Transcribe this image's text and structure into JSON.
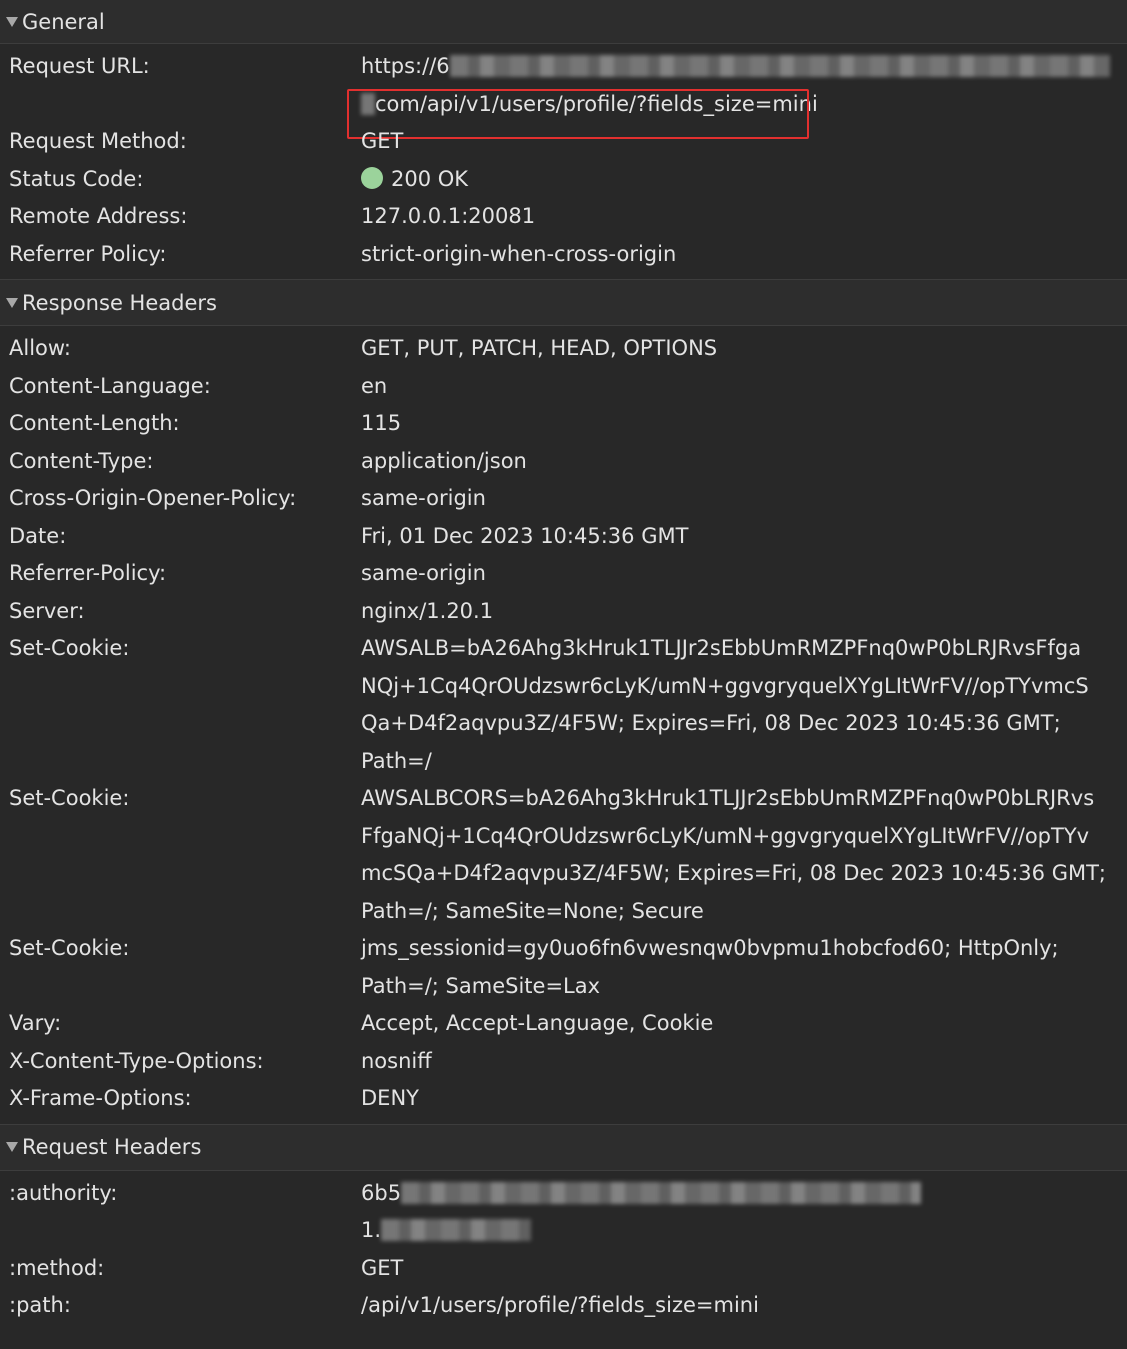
{
  "general": {
    "title": "General",
    "request_url_key": "Request URL:",
    "request_url_line1": "https://6",
    "request_url_line2": "com/api/v1/users/profile/?fields_size=mini",
    "request_method_key": "Request Method:",
    "request_method": "GET",
    "status_code_key": "Status Code:",
    "status_code": "200 OK",
    "remote_address_key": "Remote Address:",
    "remote_address": "127.0.0.1:20081",
    "referrer_policy_key": "Referrer Policy:",
    "referrer_policy": "strict-origin-when-cross-origin"
  },
  "response_headers": {
    "title": "Response Headers",
    "allow_key": "Allow:",
    "allow": "GET, PUT, PATCH, HEAD, OPTIONS",
    "content_language_key": "Content-Language:",
    "content_language": "en",
    "content_length_key": "Content-Length:",
    "content_length": "115",
    "content_type_key": "Content-Type:",
    "content_type": "application/json",
    "coop_key": "Cross-Origin-Opener-Policy:",
    "coop": "same-origin",
    "date_key": "Date:",
    "date": "Fri, 01 Dec 2023 10:45:36 GMT",
    "referrer_policy_key": "Referrer-Policy:",
    "referrer_policy": "same-origin",
    "server_key": "Server:",
    "server": "nginx/1.20.1",
    "set_cookie_key": "Set-Cookie:",
    "cookie1": [
      "AWSALB=bA26Ahg3kHruk1TLJJr2sEbbUmRMZPFnq0wP0bLRJRvsFfga",
      "NQj+1Cq4QrOUdzswr6cLyK/umN+ggvgryquelXYgLItWrFV//opTYvmcS",
      "Qa+D4f2aqvpu3Z/4F5W; Expires=Fri, 08 Dec 2023 10:45:36 GMT;",
      "Path=/"
    ],
    "cookie2": [
      "AWSALBCORS=bA26Ahg3kHruk1TLJJr2sEbbUmRMZPFnq0wP0bLRJRvs",
      "FfgaNQj+1Cq4QrOUdzswr6cLyK/umN+ggvgryquelXYgLItWrFV//opTYv",
      "mcSQa+D4f2aqvpu3Z/4F5W; Expires=Fri, 08 Dec 2023 10:45:36 GMT;",
      "Path=/; SameSite=None; Secure"
    ],
    "cookie3": [
      "jms_sessionid=gy0uo6fn6vwesnqw0bvpmu1hobcfod60; HttpOnly;",
      "Path=/; SameSite=Lax"
    ],
    "vary_key": "Vary:",
    "vary": "Accept, Accept-Language, Cookie",
    "xcto_key": "X-Content-Type-Options:",
    "xcto": "nosniff",
    "xfo_key": "X-Frame-Options:",
    "xfo": "DENY"
  },
  "request_headers": {
    "title": "Request Headers",
    "authority_key": ":authority:",
    "authority_line1": "6b5",
    "authority_line2": "1.",
    "method_key": ":method:",
    "method": "GET",
    "path_key": ":path:",
    "path": "/api/v1/users/profile/?fields_size=mini"
  },
  "colors": {
    "background": "#282828",
    "highlight_border": "#e2302f",
    "status_dot": "#9bd39b"
  }
}
